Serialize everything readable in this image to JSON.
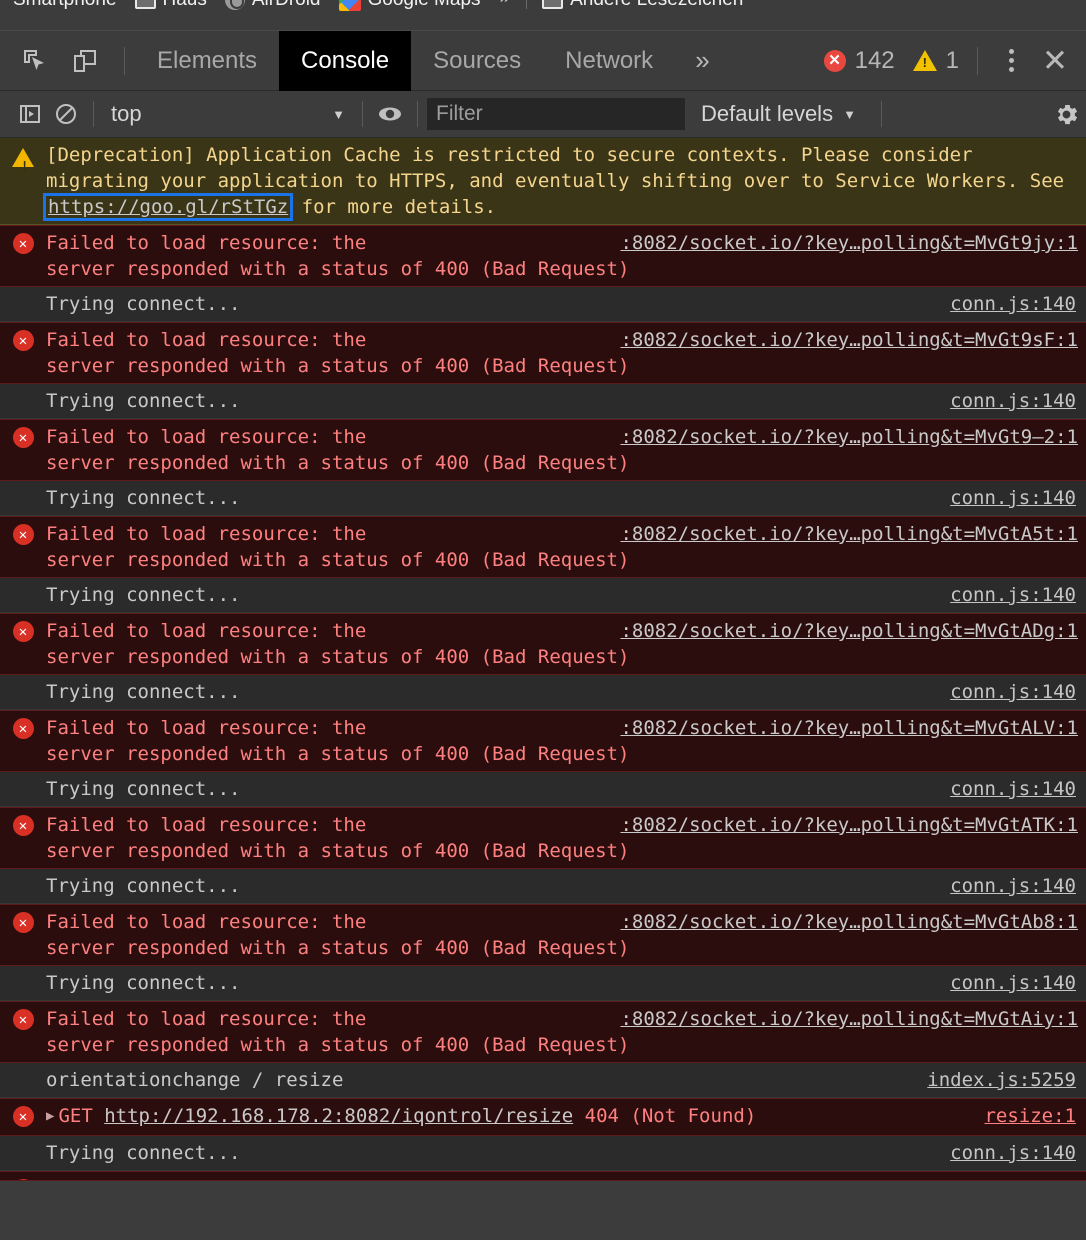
{
  "bookmarks": {
    "items": [
      {
        "label": "Smartphone",
        "icon": "none"
      },
      {
        "label": "Haus",
        "icon": "folder-icon"
      },
      {
        "label": "AirDroid",
        "icon": "airdroid-icon"
      },
      {
        "label": "Google Maps",
        "icon": "google-maps-icon"
      }
    ],
    "overflow_label": "»",
    "other_bookmarks": {
      "label": "Andere Lesezeichen",
      "icon": "folder-icon"
    }
  },
  "devtools": {
    "tabs": [
      {
        "label": "Elements",
        "active": false
      },
      {
        "label": "Console",
        "active": true
      },
      {
        "label": "Sources",
        "active": false
      },
      {
        "label": "Network",
        "active": false
      }
    ],
    "more_tabs_label": "»",
    "error_count": "142",
    "warning_count": "1",
    "icons": {
      "inspect": "inspect-element-icon",
      "device": "device-toolbar-icon",
      "kebab": "more-options-icon",
      "close": "close-devtools-icon"
    }
  },
  "console_toolbar": {
    "sidebar_toggle": "console-sidebar-icon",
    "clear_console": "clear-console-icon",
    "context": "top",
    "eye": "live-expression-icon",
    "filter_placeholder": "Filter",
    "filter_value": "",
    "levels": "Default levels",
    "settings": "settings-gear-icon"
  },
  "console_rows": [
    {
      "type": "warning",
      "badge": "warning-icon",
      "segments": [
        {
          "t": "text",
          "v": "[Deprecation] Application Cache is restricted to secure contexts. Please consider migrating your application to HTTPS, and eventually shifting over to Service Workers. See "
        },
        {
          "t": "focus-link",
          "v": "https://goo.gl/rStTGz"
        },
        {
          "t": "text",
          "v": " for more details."
        }
      ],
      "source": ""
    },
    {
      "type": "error",
      "badge": "error-icon",
      "msg_a": "Failed to load resource: the",
      "msg_b": "server responded with a status of 400 (Bad Request)",
      "link": ":8082/socket.io/?key…polling&t=MvGt9jy:1"
    },
    {
      "type": "info",
      "badge": "",
      "text": "Trying connect...",
      "source": "conn.js:140"
    },
    {
      "type": "error",
      "badge": "error-icon",
      "msg_a": "Failed to load resource: the",
      "msg_b": "server responded with a status of 400 (Bad Request)",
      "link": ":8082/socket.io/?key…polling&t=MvGt9sF:1"
    },
    {
      "type": "info",
      "badge": "",
      "text": "Trying connect...",
      "source": "conn.js:140"
    },
    {
      "type": "error",
      "badge": "error-icon",
      "msg_a": "Failed to load resource: the",
      "msg_b": "server responded with a status of 400 (Bad Request)",
      "link": ":8082/socket.io/?key…polling&t=MvGt9–2:1"
    },
    {
      "type": "info",
      "badge": "",
      "text": "Trying connect...",
      "source": "conn.js:140"
    },
    {
      "type": "error",
      "badge": "error-icon",
      "msg_a": "Failed to load resource: the",
      "msg_b": "server responded with a status of 400 (Bad Request)",
      "link": ":8082/socket.io/?key…polling&t=MvGtA5t:1"
    },
    {
      "type": "info",
      "badge": "",
      "text": "Trying connect...",
      "source": "conn.js:140"
    },
    {
      "type": "error",
      "badge": "error-icon",
      "msg_a": "Failed to load resource: the",
      "msg_b": "server responded with a status of 400 (Bad Request)",
      "link": ":8082/socket.io/?key…polling&t=MvGtADg:1"
    },
    {
      "type": "info",
      "badge": "",
      "text": "Trying connect...",
      "source": "conn.js:140"
    },
    {
      "type": "error",
      "badge": "error-icon",
      "msg_a": "Failed to load resource: the",
      "msg_b": "server responded with a status of 400 (Bad Request)",
      "link": ":8082/socket.io/?key…polling&t=MvGtALV:1"
    },
    {
      "type": "info",
      "badge": "",
      "text": "Trying connect...",
      "source": "conn.js:140"
    },
    {
      "type": "error",
      "badge": "error-icon",
      "msg_a": "Failed to load resource: the",
      "msg_b": "server responded with a status of 400 (Bad Request)",
      "link": ":8082/socket.io/?key…polling&t=MvGtATK:1"
    },
    {
      "type": "info",
      "badge": "",
      "text": "Trying connect...",
      "source": "conn.js:140"
    },
    {
      "type": "error",
      "badge": "error-icon",
      "msg_a": "Failed to load resource: the",
      "msg_b": "server responded with a status of 400 (Bad Request)",
      "link": ":8082/socket.io/?key…polling&t=MvGtAb8:1"
    },
    {
      "type": "info",
      "badge": "",
      "text": "Trying connect...",
      "source": "conn.js:140"
    },
    {
      "type": "error",
      "badge": "error-icon",
      "msg_a": "Failed to load resource: the",
      "msg_b": "server responded with a status of 400 (Bad Request)",
      "link": ":8082/socket.io/?key…polling&t=MvGtAiy:1"
    },
    {
      "type": "info",
      "badge": "",
      "text": "orientationchange / resize",
      "source": "index.js:5259"
    },
    {
      "type": "error-get",
      "badge": "error-icon",
      "method": "GET",
      "url": "http://192.168.178.2:8082/iqontrol/resize",
      "status": "404 (Not Found)",
      "source": "resize:1"
    },
    {
      "type": "info",
      "badge": "",
      "text": "Trying connect...",
      "source": "conn.js:140"
    },
    {
      "type": "error-partial",
      "badge": "error-icon"
    }
  ]
}
